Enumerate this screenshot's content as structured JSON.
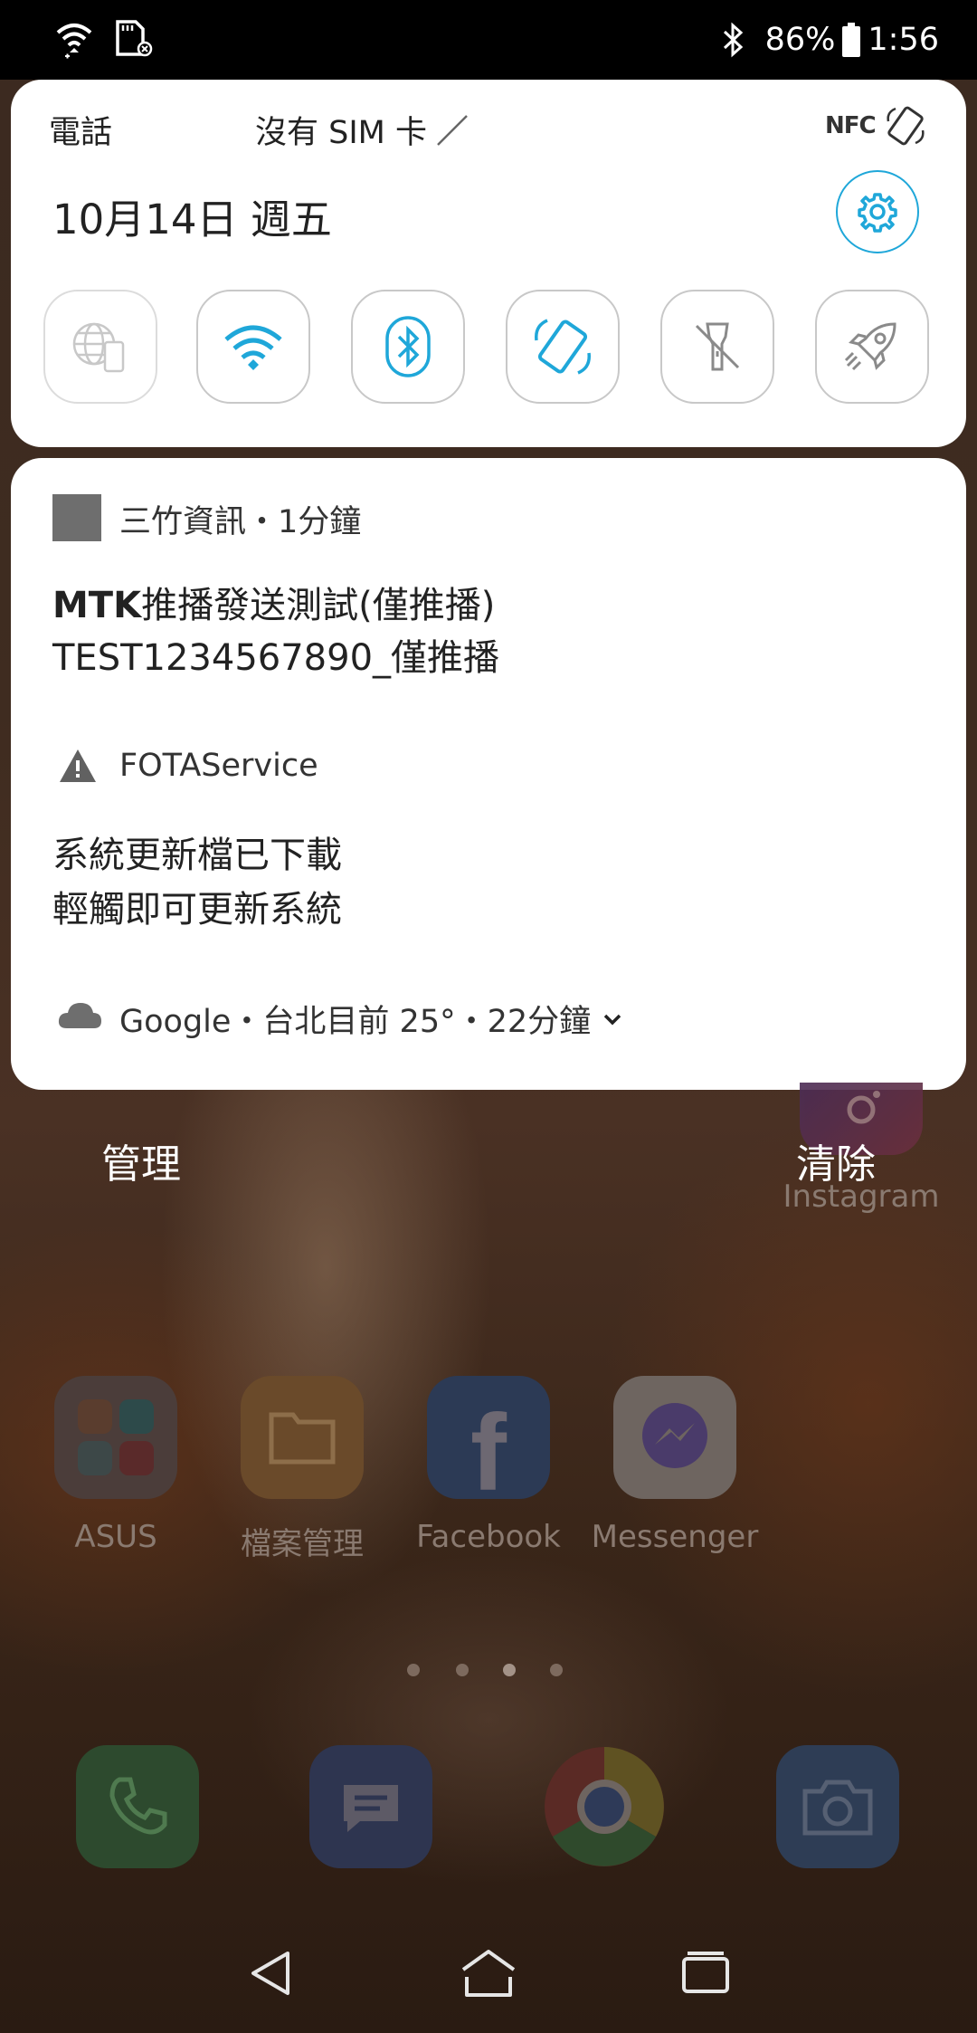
{
  "status_bar": {
    "battery": "86%",
    "time": "1:56"
  },
  "quick_settings": {
    "phone_label": "電話",
    "sim_label": "沒有 SIM 卡",
    "nfc_label": "NFC",
    "date": "10月14日 週五",
    "accent_color": "#1fa7d9",
    "tiles": [
      "mobile-data",
      "wifi",
      "bluetooth",
      "auto-rotate",
      "flashlight",
      "game-genie"
    ]
  },
  "notifications": [
    {
      "app": "三竹資訊・1分鐘",
      "title_bold": "MTK",
      "title_rest": "推播發送測試(僅推播)",
      "text": "TEST1234567890_僅推播"
    },
    {
      "app": "FOTAService",
      "line1": "系統更新檔已下載",
      "line2": "輕觸即可更新系統"
    },
    {
      "text": "Google・台北目前 25°・22分鐘"
    }
  ],
  "actions": {
    "manage": "管理",
    "clear": "清除"
  },
  "home": {
    "instagram": "Instagram",
    "apps": [
      "ASUS",
      "檔案管理",
      "Facebook",
      "Messenger"
    ]
  }
}
